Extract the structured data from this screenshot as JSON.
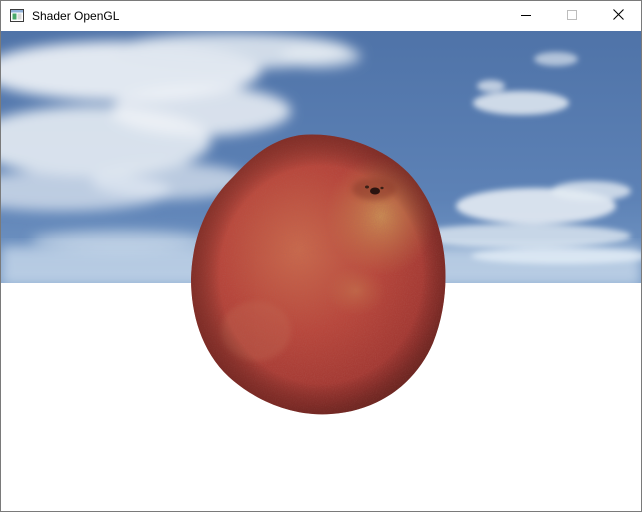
{
  "window": {
    "title": "Shader OpenGL",
    "icon": "app-window-icon",
    "controls": {
      "minimize_icon": "minimize-icon",
      "maximize_icon": "maximize-icon",
      "close_icon": "close-icon"
    }
  },
  "scene": {
    "subject": "textured-apple-model",
    "background": "skybox-sky-and-clouds",
    "colors": {
      "sky_top": "#5a7eb3",
      "sky_horizon": "#cfe6f4",
      "ground": "#ffffff",
      "apple_base": "#b5473b",
      "apple_highlight": "#c9a35a",
      "apple_shadow": "#7e2f2a"
    }
  }
}
